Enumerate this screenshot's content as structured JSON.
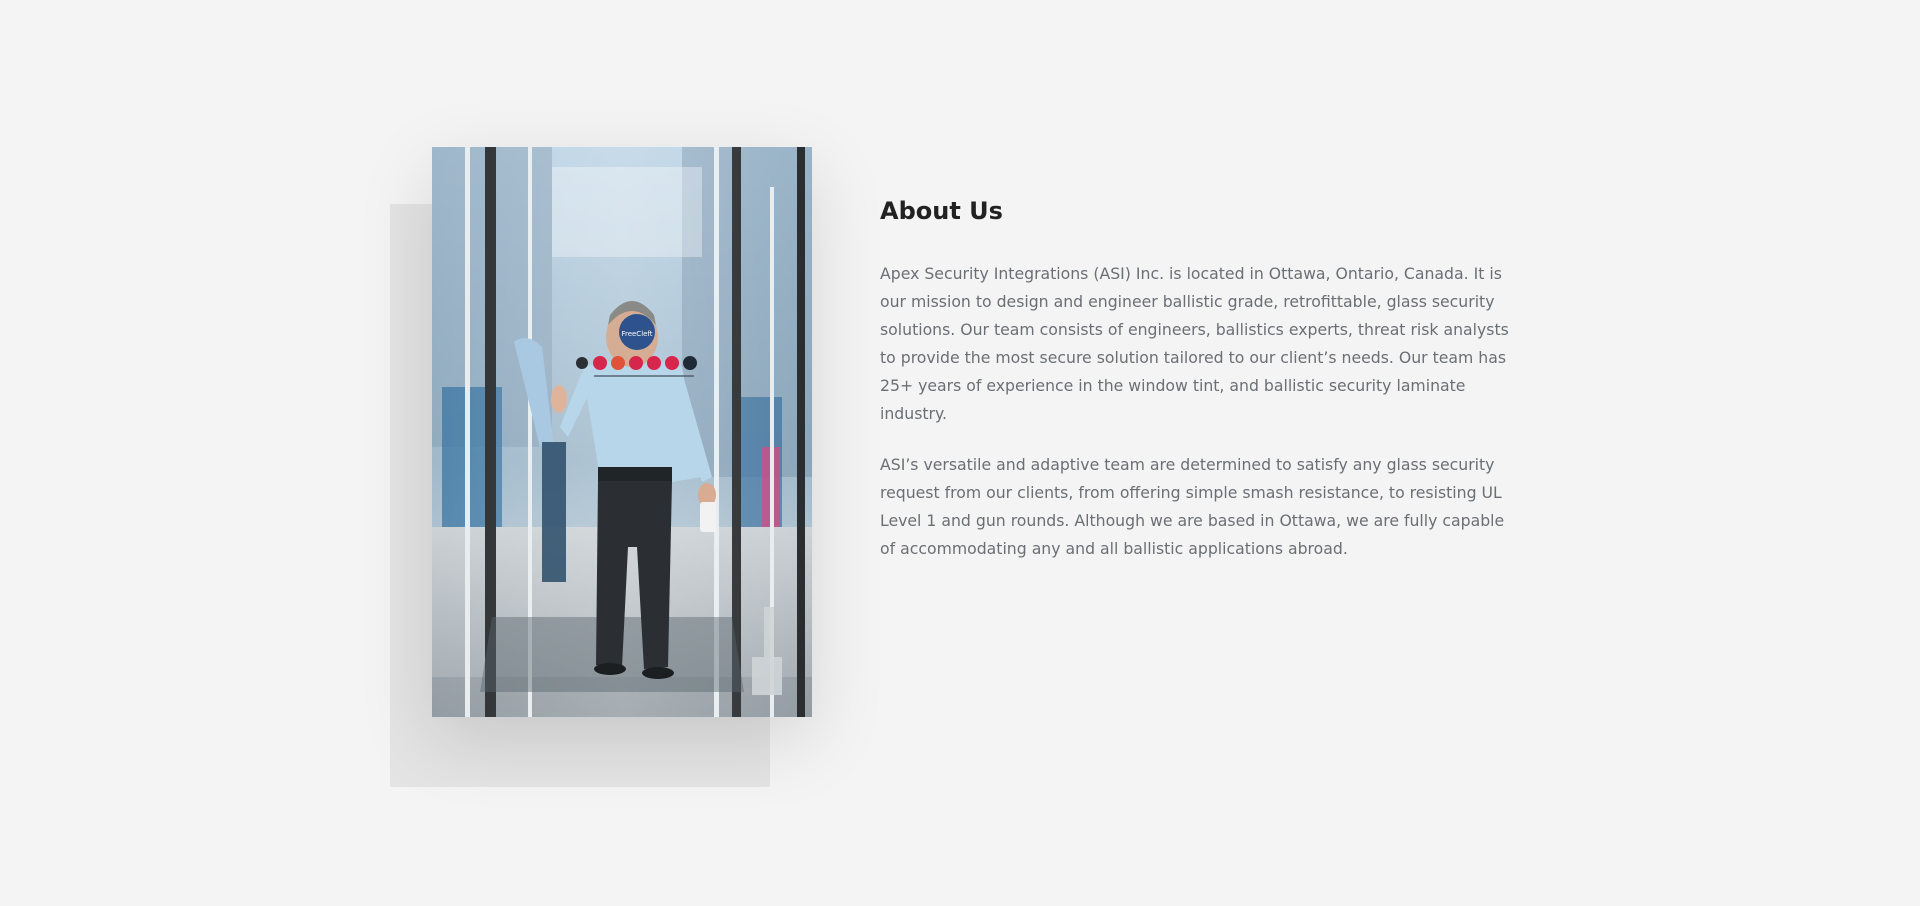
{
  "about": {
    "heading": "About Us",
    "paragraphs": [
      "Apex Security Integrations (ASI) Inc. is located in Ottawa, Ontario, Canada. It is our mission to design and engineer ballistic grade, retrofittable, glass security solutions. Our team consists of engineers, ballistics experts, threat risk analysts to provide the most secure solution tailored to our client’s needs. Our team has 25+ years of experience in the window tint, and ballistic security laminate industry.",
      "ASI’s versatile and adaptive team are determined to satisfy any glass security request from our clients, from offering simple smash resistance, to resisting UL Level 1 and gun rounds. Although we are based in Ottawa, we are fully capable of accommodating any and all ballistic applications abroad."
    ],
    "image": {
      "description_icon": "man-testing-security-glass-door-photo",
      "badge_text": "FreeCleft"
    }
  },
  "colors": {
    "page_background": "#f4f4f4",
    "backdrop": "#e4e4e4",
    "heading": "#222222",
    "body_text": "#6b6f74"
  }
}
